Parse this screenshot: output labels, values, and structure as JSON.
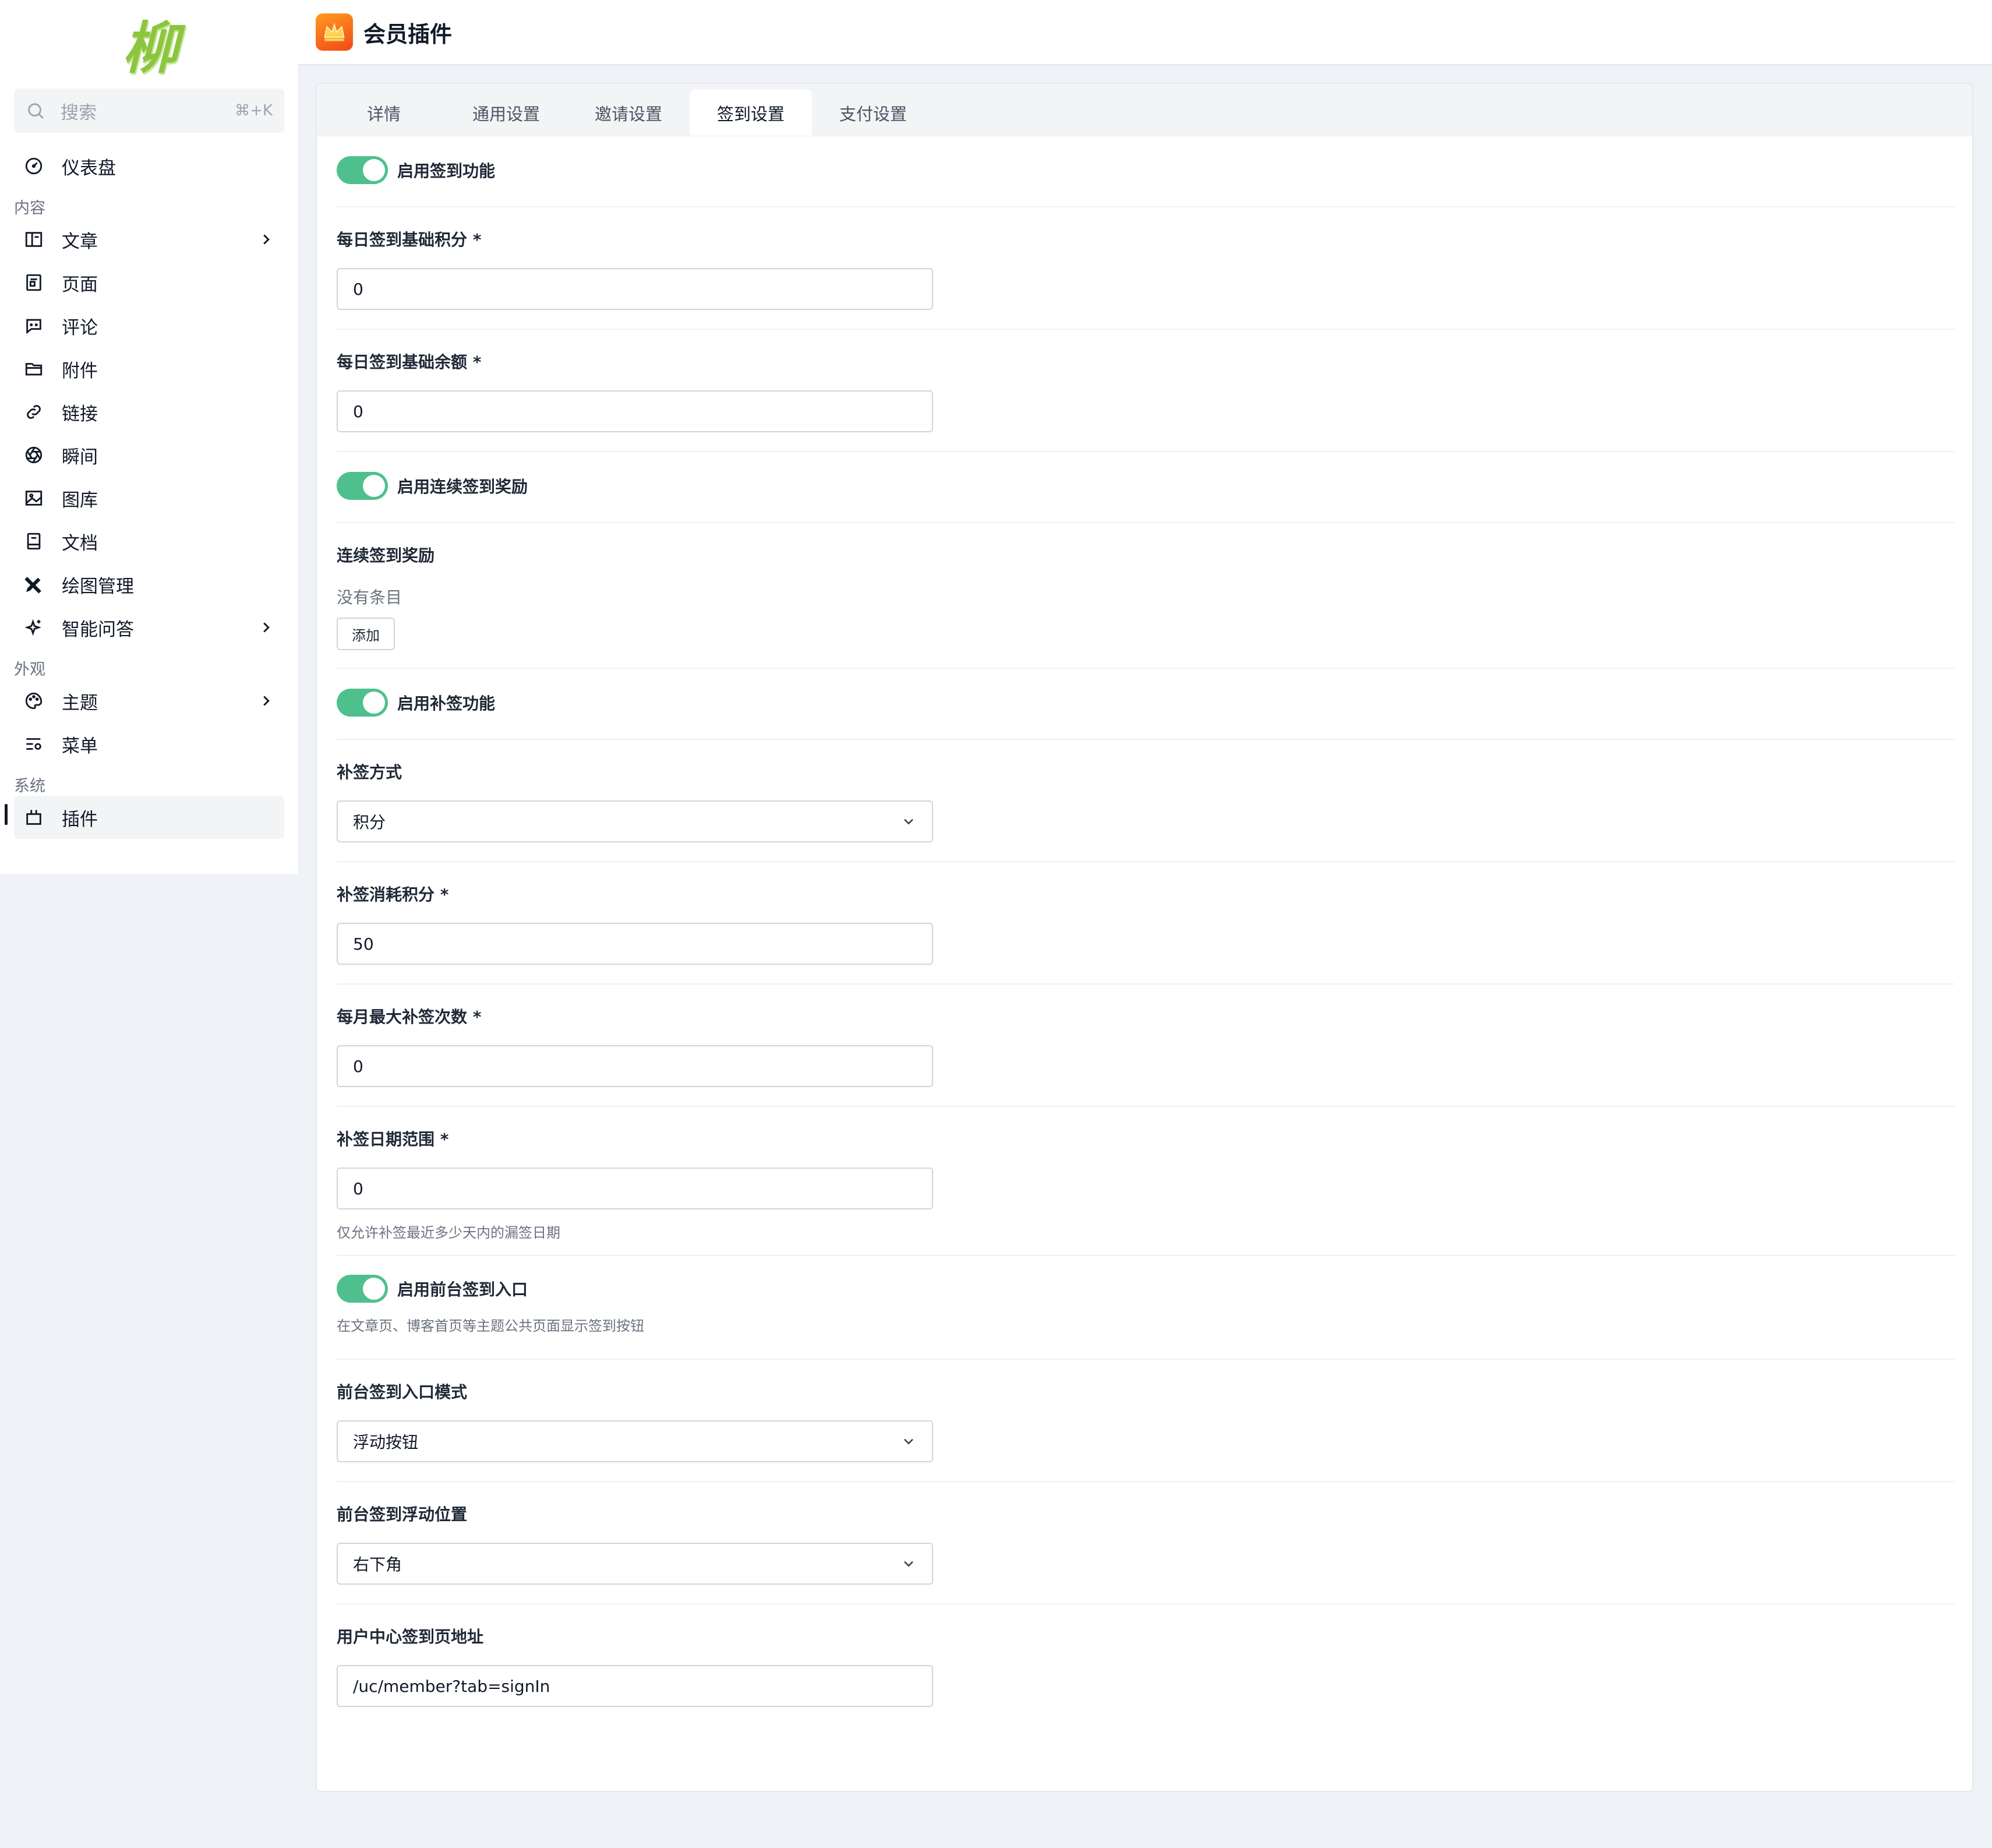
{
  "logo": {
    "text": "柳"
  },
  "search": {
    "placeholder": "搜索",
    "shortcut": "⌘+K"
  },
  "sidebar": {
    "dashboard": "仪表盘",
    "groups": {
      "content": "内容",
      "appearance": "外观",
      "system": "系统"
    },
    "items": {
      "posts": "文章",
      "pages": "页面",
      "comments": "评论",
      "attachments": "附件",
      "links": "链接",
      "moments": "瞬间",
      "gallery": "图库",
      "docs": "文档",
      "drawing": "绘图管理",
      "ai_qa": "智能问答",
      "themes": "主题",
      "menus": "菜单",
      "plugins": "插件"
    }
  },
  "header": {
    "title": "会员插件",
    "icon": "crown-app-icon"
  },
  "tabs": [
    "详情",
    "通用设置",
    "邀请设置",
    "签到设置",
    "支付设置"
  ],
  "active_tab": "签到设置",
  "form": {
    "enable_signin": {
      "label": "启用签到功能",
      "enabled": true
    },
    "daily_points": {
      "label": "每日签到基础积分 *",
      "value": "0"
    },
    "daily_balance": {
      "label": "每日签到基础余额 *",
      "value": "0"
    },
    "enable_streak": {
      "label": "启用连续签到奖励",
      "enabled": true
    },
    "streak_rewards": {
      "label": "连续签到奖励",
      "empty_text": "没有条目",
      "add_button": "添加"
    },
    "enable_makeup": {
      "label": "启用补签功能",
      "enabled": true
    },
    "makeup_method": {
      "label": "补签方式",
      "value": "积分"
    },
    "makeup_cost": {
      "label": "补签消耗积分 *",
      "value": "50"
    },
    "makeup_monthly_max": {
      "label": "每月最大补签次数 *",
      "value": "0"
    },
    "makeup_range": {
      "label": "补签日期范围 *",
      "value": "0",
      "help": "仅允许补签最近多少天内的漏签日期"
    },
    "enable_frontend_entry": {
      "label": "启用前台签到入口",
      "enabled": true,
      "help": "在文章页、博客首页等主题公共页面显示签到按钮"
    },
    "frontend_mode": {
      "label": "前台签到入口模式",
      "value": "浮动按钮"
    },
    "frontend_position": {
      "label": "前台签到浮动位置",
      "value": "右下角"
    },
    "uc_signin_url": {
      "label": "用户中心签到页地址",
      "value": "/uc/member?tab=signIn"
    }
  },
  "colors": {
    "accent": "#4fc08d",
    "brand_icon": "#f36b1c",
    "logo": "#8cc63f"
  }
}
